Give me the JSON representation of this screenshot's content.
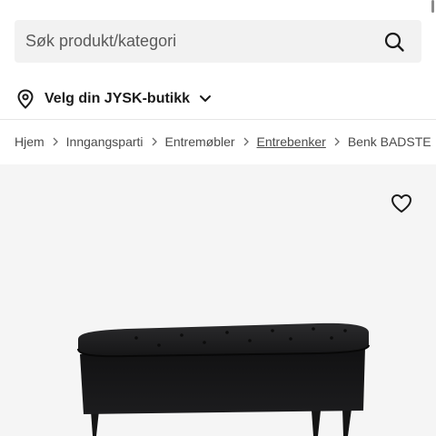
{
  "search": {
    "placeholder": "Søk produkt/kategori"
  },
  "store_selector": {
    "label": "Velg din JYSK-butikk"
  },
  "breadcrumb": [
    {
      "label": "Hjem"
    },
    {
      "label": "Inngangsparti"
    },
    {
      "label": "Entremøbler"
    },
    {
      "label": "Entrebenker"
    },
    {
      "label": "Benk BADSTE"
    }
  ],
  "icons": {
    "search": "search-icon",
    "store": "location-pin-icon",
    "dropdown": "chevron-down-icon",
    "separator": "chevron-right-icon",
    "favorite": "heart-icon"
  },
  "colors": {
    "search_bg": "#f2f2f2",
    "text_dark": "#1a1a1a",
    "gallery_bg": "#f5f5f5"
  }
}
